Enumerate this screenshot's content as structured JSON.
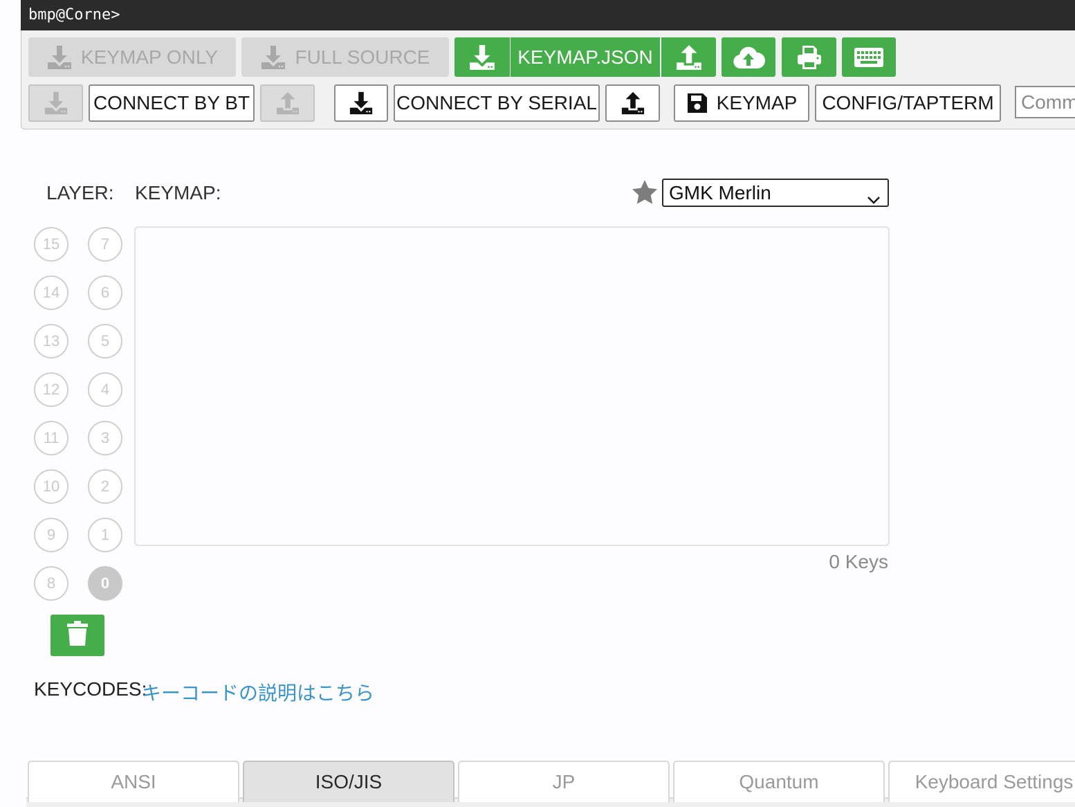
{
  "terminal": {
    "prompt": "bmp@Corne>"
  },
  "toolbar": {
    "row1": {
      "keymap_only_label": "KEYMAP ONLY",
      "full_source_label": "FULL SOURCE",
      "keymap_json_label": "KEYMAP.JSON"
    },
    "row2": {
      "connect_bt_label": "CONNECT BY BT",
      "connect_serial_label": "CONNECT BY SERIAL",
      "keymap_label": "KEYMAP",
      "config_label": "CONFIG/TAPTERM",
      "command_placeholder": "Command"
    }
  },
  "layer": {
    "label": "LAYER:",
    "left_column": [
      "15",
      "14",
      "13",
      "12",
      "11",
      "10",
      "9",
      "8"
    ],
    "right_column": [
      "7",
      "6",
      "5",
      "4",
      "3",
      "2",
      "1",
      "0"
    ],
    "active": "0"
  },
  "keymap": {
    "label": "KEYMAP:",
    "theme_selected": "GMK Merlin",
    "key_count": "0",
    "keys_suffix": "Keys"
  },
  "keycodes": {
    "label": "KEYCODES:",
    "link_text": "キーコードの説明はこちら"
  },
  "tabs": [
    {
      "label": "ANSI",
      "active": false
    },
    {
      "label": "ISO/JIS",
      "active": true
    },
    {
      "label": "JP",
      "active": false
    },
    {
      "label": "Quantum",
      "active": false
    },
    {
      "label": "Keyboard Settings",
      "active": false
    }
  ],
  "colors": {
    "accent_green": "#46ad4b",
    "link_blue": "#3a94c6",
    "terminal_bg": "#2b2b2b"
  }
}
